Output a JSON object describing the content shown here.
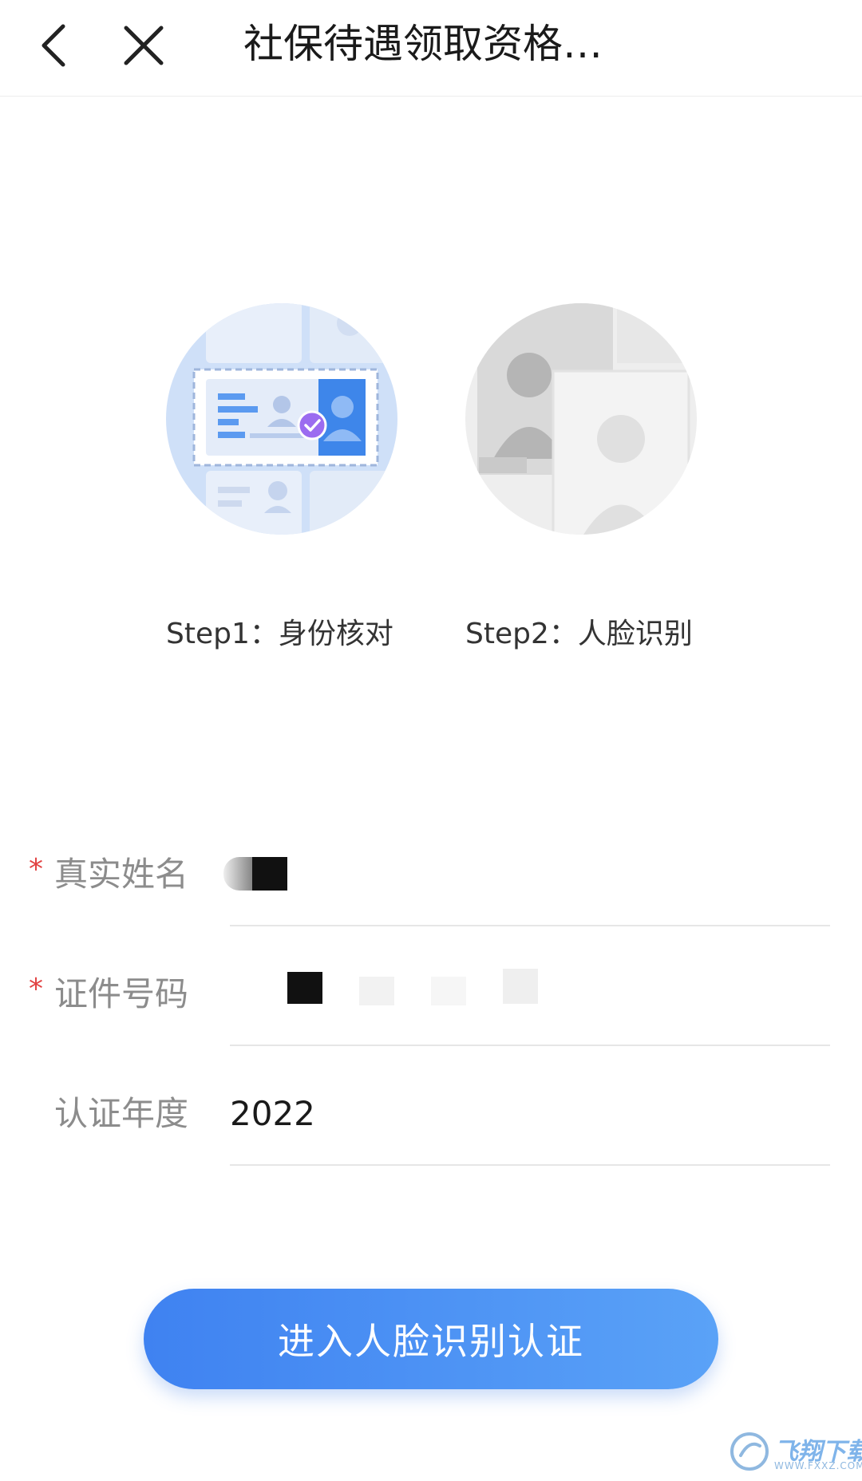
{
  "header": {
    "title": "社保待遇领取资格…",
    "back_icon": "chevron-left-icon",
    "close_icon": "close-icon"
  },
  "steps": [
    {
      "label": "Step1：身份核对",
      "illustration": "id-card-check-illustration",
      "state": "active"
    },
    {
      "label": "Step2：人脸识别",
      "illustration": "face-recognition-illustration",
      "state": "inactive"
    }
  ],
  "form": {
    "name": {
      "label": "真实姓名",
      "required": "*"
    },
    "id_number": {
      "label": "证件号码",
      "required": "*"
    },
    "year": {
      "label": "认证年度",
      "value": "2022"
    }
  },
  "submit": {
    "label": "进入人脸识别认证"
  },
  "watermark": {
    "text": "飞翔下载",
    "domain": "WWW.FXXZ.COM"
  },
  "colors": {
    "accent": "#3f82f1",
    "accent_end": "#5aa2f7",
    "required": "#e24444",
    "check_badge": "#9b6cf0"
  }
}
